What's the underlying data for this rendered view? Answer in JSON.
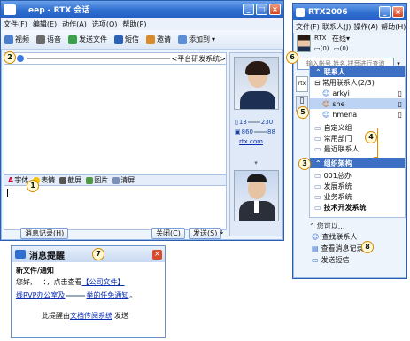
{
  "chat": {
    "title": "eep - RTX 会话",
    "menu": [
      "文件(F)",
      "编辑(E)",
      "动作(A)",
      "选项(O)",
      "帮助(P)"
    ],
    "toolbar": [
      "视频",
      "语音",
      "发送文件",
      "短信",
      "邀请",
      "添加到"
    ],
    "recipient": "<平台研发系统>",
    "contact_phone": "13",
    "contact_phone_tail": "230",
    "contact_id": "860",
    "contact_id_tail": "88",
    "contact_link": "rtx.com",
    "fmt": [
      "字体",
      "表情",
      "截屏",
      "图片",
      "清屏"
    ],
    "history_btn": "消息记录(H)",
    "close_btn": "关闭(C)",
    "send_btn": "发送(S)"
  },
  "main": {
    "title": "RTX2006",
    "menu": [
      "文件(F)",
      "联系人(J)",
      "操作(A)",
      "帮助(H)"
    ],
    "user_name": "RTX",
    "status": "在线",
    "count_1": "(0)",
    "count_2": "(0)",
    "search_placeholder": "输入帐号,姓名,拼音进行查询",
    "sec_contacts": "联系人",
    "group_common": "常用联系人(2/3)",
    "contacts": [
      "arkyi",
      "she",
      "hmena"
    ],
    "folders": [
      "自定义组",
      "常用部门",
      "最近联系人"
    ],
    "sec_org": "组织架构",
    "org": [
      "001总办",
      "发展系统",
      "业务系统",
      "技术开发系统"
    ],
    "prompt": "您可以...",
    "actions": [
      "查找联系人",
      "查看消息记录",
      "发送短信"
    ]
  },
  "notice": {
    "title": "消息提醒",
    "subject": "新文件/通知",
    "line1_a": "您好,",
    "line1_b": "：，点击查看",
    "line1_link": "【公司文件】",
    "line2_a": "线RVP办公室及",
    "line2_b": "举的任免通知",
    "line2_c": "。",
    "footer_a": "此提醒由",
    "footer_link": "文档传阅系统",
    "footer_b": "发送"
  },
  "badges": [
    "1",
    "2",
    "3",
    "4",
    "5",
    "6",
    "7",
    "8"
  ]
}
